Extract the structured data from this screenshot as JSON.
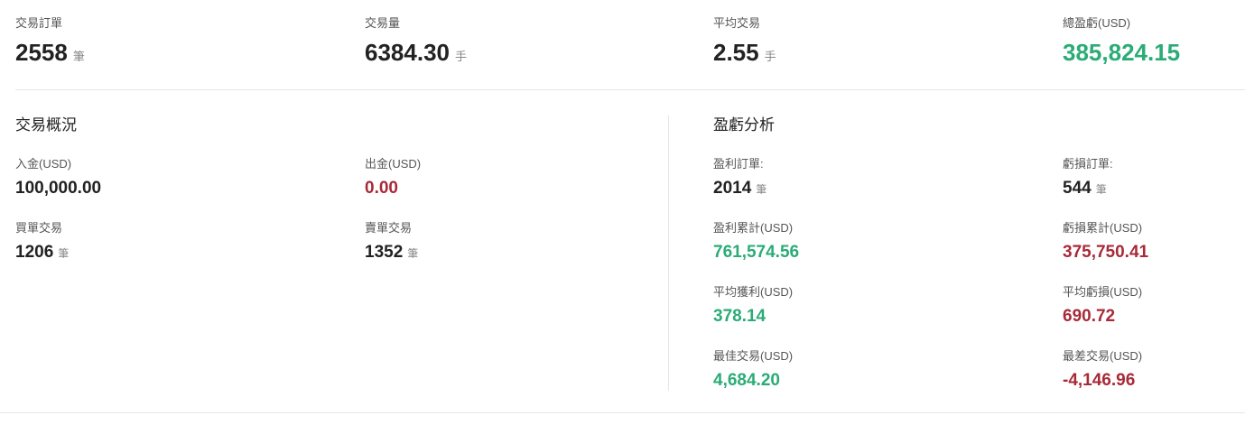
{
  "summary": {
    "trade_orders": {
      "label": "交易訂單",
      "value": "2558",
      "unit": "筆"
    },
    "trade_volume": {
      "label": "交易量",
      "value": "6384.30",
      "unit": "手"
    },
    "average_trade": {
      "label": "平均交易",
      "value": "2.55",
      "unit": "手"
    },
    "total_pnl": {
      "label": "總盈虧(USD)",
      "value": "385,824.15"
    }
  },
  "overview": {
    "title": "交易概況",
    "deposit": {
      "label": "入金(USD)",
      "value": "100,000.00"
    },
    "withdrawal": {
      "label": "出金(USD)",
      "value": "0.00"
    },
    "buy_trades": {
      "label": "買單交易",
      "value": "1206",
      "unit": "筆"
    },
    "sell_trades": {
      "label": "賣單交易",
      "value": "1352",
      "unit": "筆"
    }
  },
  "pnl_analysis": {
    "title": "盈虧分析",
    "profit_orders": {
      "label": "盈利訂單:",
      "value": "2014",
      "unit": "筆"
    },
    "loss_orders": {
      "label": "虧損訂單:",
      "value": "544",
      "unit": "筆"
    },
    "profit_total": {
      "label": "盈利累計(USD)",
      "value": "761,574.56"
    },
    "loss_total": {
      "label": "虧損累計(USD)",
      "value": "375,750.41"
    },
    "avg_profit": {
      "label": "平均獲利(USD)",
      "value": "378.14"
    },
    "avg_loss": {
      "label": "平均虧損(USD)",
      "value": "690.72"
    },
    "best_trade": {
      "label": "最佳交易(USD)",
      "value": "4,684.20"
    },
    "worst_trade": {
      "label": "最差交易(USD)",
      "value": "-4,146.96"
    }
  },
  "colors": {
    "positive": "#2bac76",
    "negative": "#a82a38"
  }
}
